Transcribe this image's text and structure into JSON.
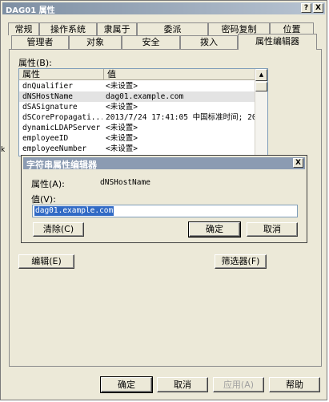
{
  "window": {
    "title": "DAG01 属性",
    "help_btn": "?",
    "close_btn": "X"
  },
  "tabs_row1": [
    "常规",
    "操作系统",
    "隶属于",
    "委派",
    "密码复制",
    "位置"
  ],
  "tabs_row2": [
    "管理者",
    "对象",
    "安全",
    "拨入",
    "属性编辑器"
  ],
  "attributes_label": "属性(B):",
  "list": {
    "col_attr": "属性",
    "col_value": "值",
    "rows": [
      {
        "attr": "dnQualifier",
        "value": "<未设置>"
      },
      {
        "attr": "dNSHostName",
        "value": "dag01.example.com"
      },
      {
        "attr": "dSASignature",
        "value": "<未设置>"
      },
      {
        "attr": "dSCorePropagati...",
        "value": "2013/7/24 17:41:05 中国标准时间; 20"
      },
      {
        "attr": "dynamicLDAPServer",
        "value": "<未设置>"
      },
      {
        "attr": "employeeID",
        "value": "<未设置>"
      },
      {
        "attr": "employeeNumber",
        "value": "<未设置>"
      }
    ]
  },
  "dialog": {
    "title": "字符串属性编辑器",
    "close_btn": "X",
    "attribute_label": "属性(A):",
    "attribute_value": "dNSHostName",
    "value_label": "值(V):",
    "value": "dag01.example.com",
    "clear_btn": "清除(C)",
    "ok_btn": "确定",
    "cancel_btn": "取消"
  },
  "edit_btn": "编辑(E)",
  "filter_btn": "筛选器(F)",
  "footer": {
    "ok": "确定",
    "cancel": "取消",
    "apply": "应用(A)",
    "help": "帮助"
  },
  "side_mark": "k"
}
